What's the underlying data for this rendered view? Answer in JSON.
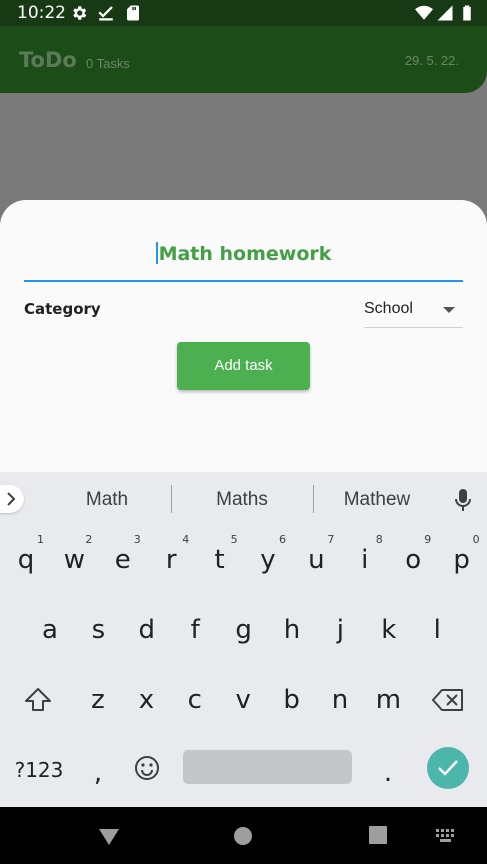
{
  "status_bar": {
    "time": "10:22",
    "icons": [
      "gear-icon",
      "check-icon",
      "sd-card-icon",
      "wifi-icon",
      "cell-signal-icon",
      "battery-icon"
    ]
  },
  "app_bar": {
    "title": "ToDo",
    "task_count": "0 Tasks",
    "date": "29. 5. 22."
  },
  "sheet": {
    "task_input": {
      "value": "Math homework"
    },
    "category_label": "Category",
    "category_value": "School",
    "add_button_label": "Add task"
  },
  "keyboard": {
    "suggestions": [
      "Math",
      "Maths",
      "Mathew"
    ],
    "rows": [
      {
        "keys": [
          "q",
          "w",
          "e",
          "r",
          "t",
          "y",
          "u",
          "i",
          "o",
          "p"
        ],
        "hints": [
          "1",
          "2",
          "3",
          "4",
          "5",
          "6",
          "7",
          "8",
          "9",
          "0"
        ]
      },
      {
        "keys": [
          "a",
          "s",
          "d",
          "f",
          "g",
          "h",
          "j",
          "k",
          "l"
        ]
      },
      {
        "keys": [
          "z",
          "x",
          "c",
          "v",
          "b",
          "n",
          "m"
        ]
      }
    ],
    "symbols_key": "?123",
    "comma_key": ",",
    "period_key": "."
  },
  "colors": {
    "status_bar": "#173a14",
    "app_bar": "#1c4d19",
    "accent_green": "#4caf50",
    "input_underline": "#2196f3",
    "enter_key": "#4db6ac"
  }
}
